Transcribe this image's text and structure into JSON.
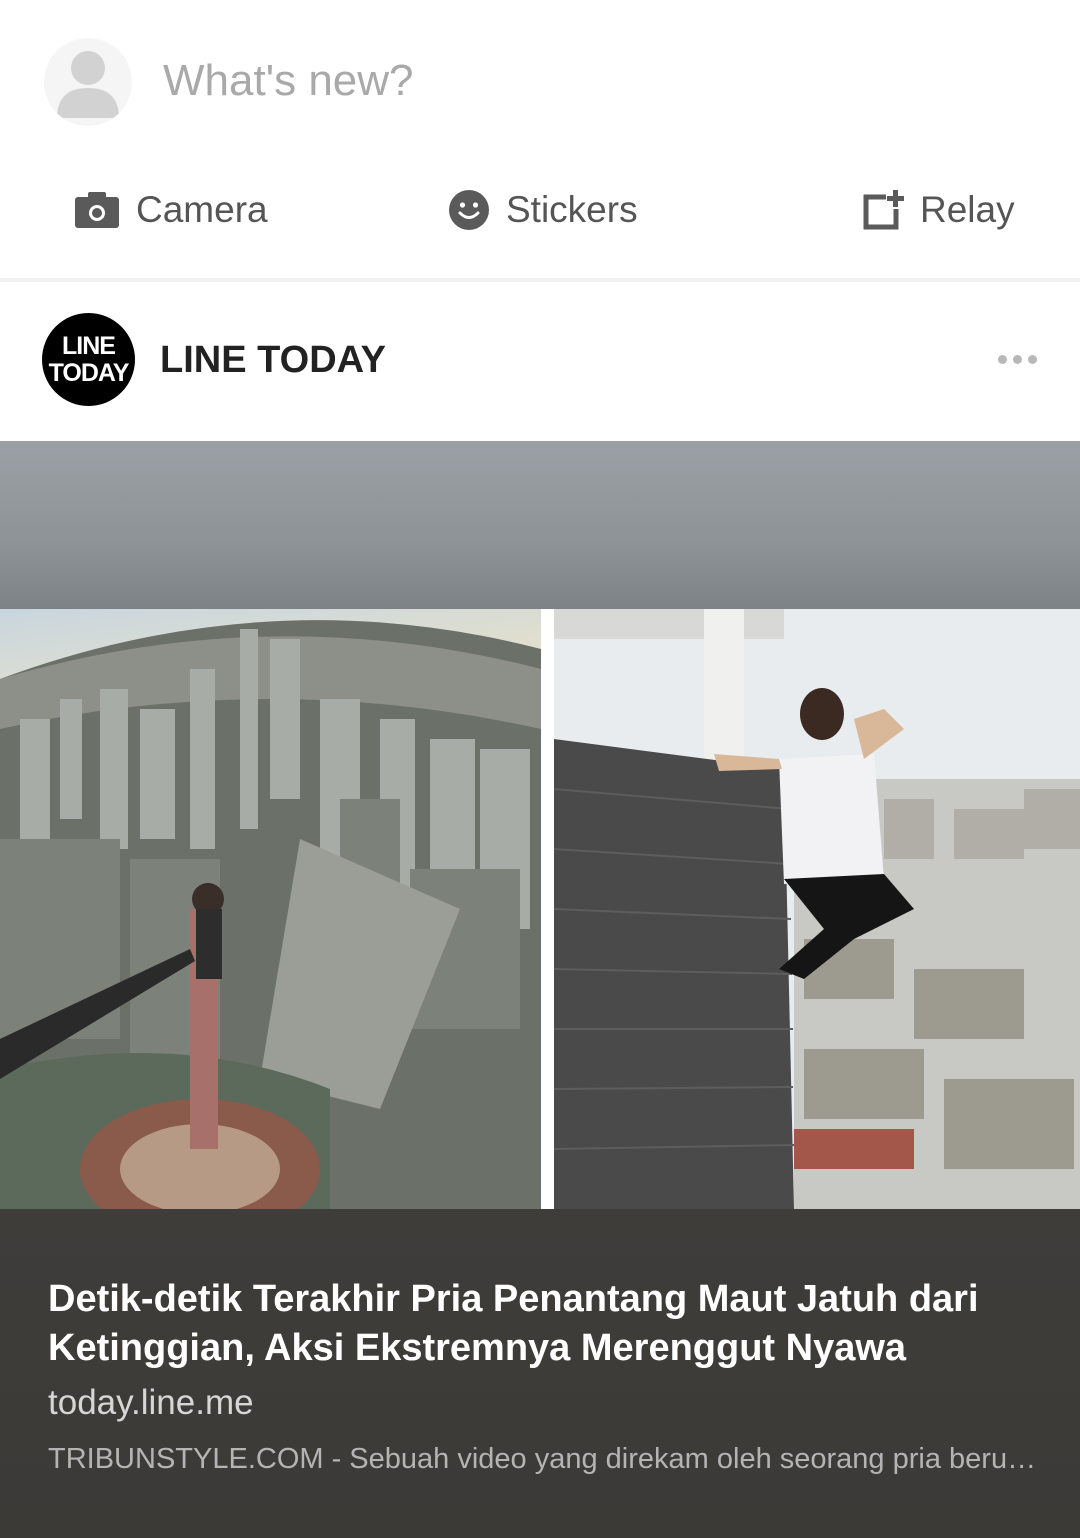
{
  "composer": {
    "prompt": "What's new?",
    "actions": [
      {
        "label": "Camera",
        "icon": "camera-icon"
      },
      {
        "label": "Stickers",
        "icon": "smiley-icon"
      },
      {
        "label": "Relay",
        "icon": "relay-icon"
      }
    ]
  },
  "post": {
    "logo_line1": "LINE",
    "logo_line2": "TODAY",
    "source_name": "LINE TODAY",
    "more_icon": "more-dots-icon",
    "headline": "Detik-detik Terakhir Pria Penantang Maut Jatuh dari Ketinggian, Aksi Ekstremnya Merenggut Nyawa",
    "domain": "today.line.me",
    "snippet": "TRIBUNSTYLE.COM - Sebuah video yang direkam oleh seorang pria beru…"
  },
  "colors": {
    "caption_bg": "#3d3b38",
    "icon_gray": "#5a5a5a",
    "placeholder": "#a9a9a9"
  }
}
